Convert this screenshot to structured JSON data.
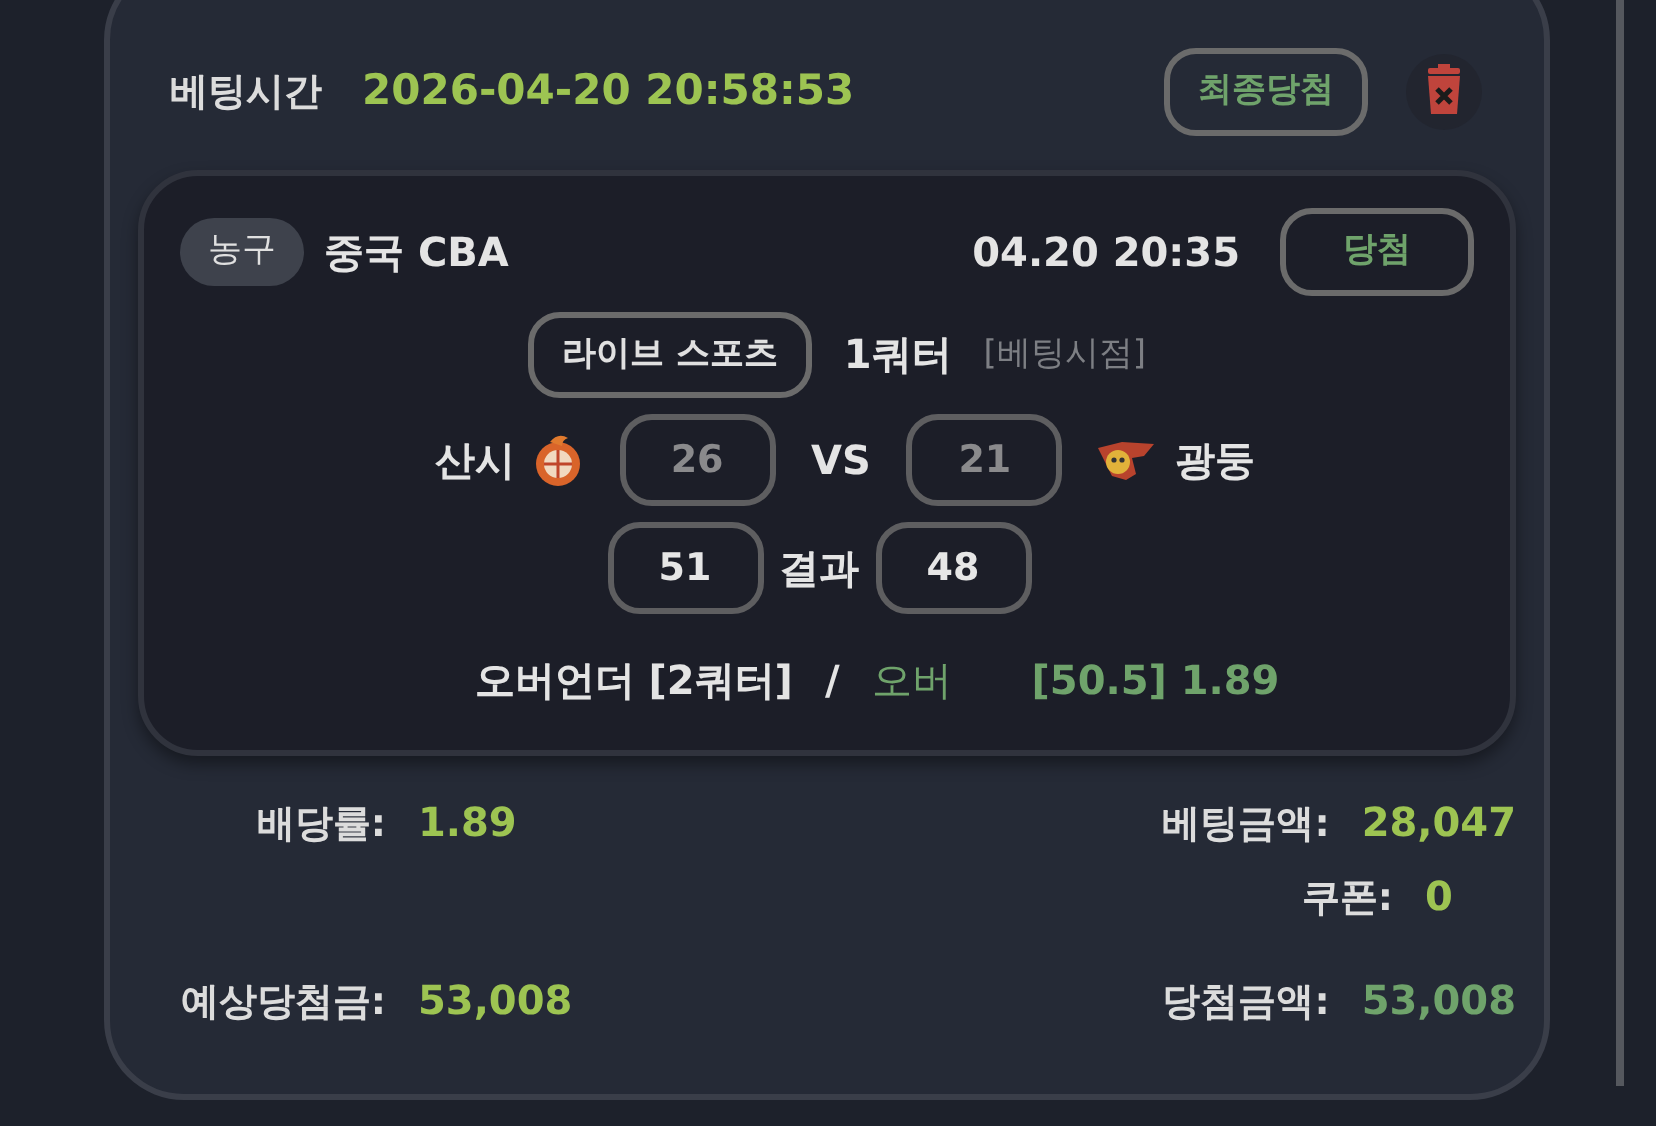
{
  "bet_time": {
    "label": "베팅시간",
    "value": "2026-04-20 20:58:53"
  },
  "status_button": "최종당첨",
  "match": {
    "sport": "농구",
    "league": "중국 CBA",
    "time": "04.20 20:35",
    "result_badge": "당첨",
    "mode": "라이브 스포츠",
    "period": "1쿼터",
    "period_note": "[베팅시점]",
    "home": "산시",
    "away": "광둥",
    "vs": "VS",
    "bet_scores": [
      "26",
      "21"
    ],
    "result_label": "결과",
    "final_scores": [
      "51",
      "48"
    ],
    "market": "오버언더 [2쿼터]",
    "separator": "/",
    "pick": "오버",
    "odds_line": "[50.5] 1.89"
  },
  "summary": [
    {
      "left": {
        "label": "배당률:",
        "value": "1.89",
        "color": "#9dc452"
      },
      "right": {
        "label": "베팅금액:",
        "value": "28,047",
        "color": "#9dc452"
      }
    },
    {
      "right": {
        "label": "쿠폰:",
        "value": "0",
        "color": "#9dc452"
      }
    },
    {
      "left": {
        "label": "예상당첨금:",
        "value": "53,008",
        "color": "#9dc452"
      },
      "right": {
        "label": "당첨금액:",
        "value": "53,008",
        "color": "#6fa36b"
      }
    }
  ]
}
